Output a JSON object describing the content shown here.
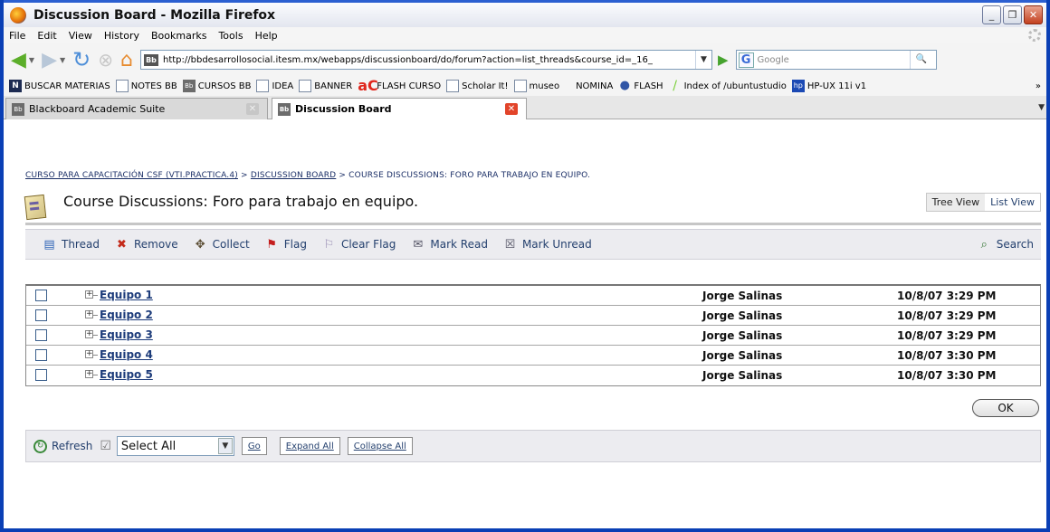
{
  "window": {
    "title": "Discussion Board - Mozilla Firefox"
  },
  "menu": {
    "items": [
      "File",
      "Edit",
      "View",
      "History",
      "Bookmarks",
      "Tools",
      "Help"
    ]
  },
  "nav": {
    "url": "http://bbdesarrollosocial.itesm.mx/webapps/discussionboard/do/forum?action=list_threads&course_id=_16_",
    "search_placeholder": "Google"
  },
  "bookmarks": [
    "BUSCAR MATERIAS",
    "NOTES BB",
    "CURSOS BB",
    "IDEA",
    "BANNER",
    "FLASH CURSO",
    "Scholar It!",
    "museo",
    "NOMINA",
    "FLASH",
    "Index of /ubuntustudio",
    "HP-UX 11i v1"
  ],
  "bookmarks_more": "»",
  "tabs": [
    {
      "label": "Blackboard Academic Suite",
      "active": false
    },
    {
      "label": "Discussion Board",
      "active": true
    }
  ],
  "breadcrumb": {
    "course": "CURSO PARA CAPACITACIÓN CSF (VTI.PRACTICA.4)",
    "sep1": " > ",
    "board": "DISCUSSION BOARD",
    "sep2": " > ",
    "current": "COURSE DISCUSSIONS: FORO PARA TRABAJO EN EQUIPO."
  },
  "page": {
    "title": "Course Discussions: Foro para trabajo en equipo."
  },
  "views": {
    "tree": "Tree View",
    "list": "List View"
  },
  "actions": {
    "thread": "Thread",
    "remove": "Remove",
    "collect": "Collect",
    "flag": "Flag",
    "clear_flag": "Clear Flag",
    "mark_read": "Mark Read",
    "mark_unread": "Mark Unread",
    "search": "Search"
  },
  "threads": [
    {
      "subject": "Equipo 1",
      "author": "Jorge Salinas",
      "date": "10/8/07 3:29 PM"
    },
    {
      "subject": "Equipo 2",
      "author": "Jorge Salinas",
      "date": "10/8/07 3:29 PM"
    },
    {
      "subject": "Equipo 3",
      "author": "Jorge Salinas",
      "date": "10/8/07 3:29 PM"
    },
    {
      "subject": "Equipo 4",
      "author": "Jorge Salinas",
      "date": "10/8/07 3:30 PM"
    },
    {
      "subject": "Equipo 5",
      "author": "Jorge Salinas",
      "date": "10/8/07 3:30 PM"
    }
  ],
  "footer": {
    "refresh": "Refresh",
    "select_value": "Select All",
    "go": "Go",
    "expand": "Expand All",
    "collapse": "Collapse All"
  },
  "ok": "OK",
  "colors": {
    "titlebar_border": "#0a3fb5",
    "link": "#1c3b7a",
    "toolbar_bg": "#ececf0",
    "tab_close": "#e2442a"
  }
}
